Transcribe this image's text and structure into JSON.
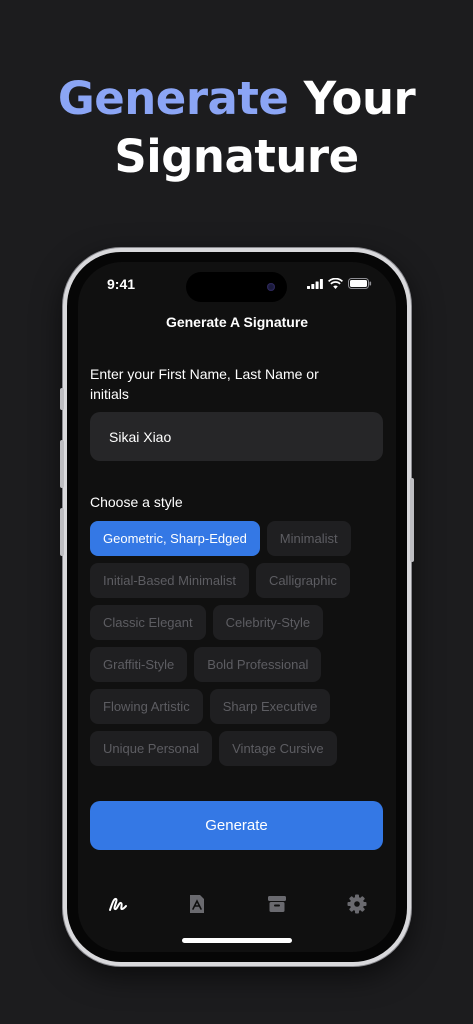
{
  "hero": {
    "title_accent": "Generate",
    "title_rest_line1": " Your",
    "title_line2": "Signature",
    "accent_color": "#8ba5f5"
  },
  "status_bar": {
    "time": "9:41",
    "icons": [
      "cellular-signal-icon",
      "wifi-icon",
      "battery-icon"
    ]
  },
  "screen": {
    "title": "Generate A Signature",
    "prompt": "Enter your First Name, Last Name or initials",
    "name_input": {
      "value": "Sikai Xiao",
      "placeholder": ""
    },
    "style_label": "Choose a style",
    "styles": [
      [
        "Geometric, Sharp-Edged",
        "Minimalist"
      ],
      [
        "Initial-Based Minimalist",
        "Calligraphic"
      ],
      [
        "Classic Elegant",
        "Celebrity-Style"
      ],
      [
        "Graffiti-Style",
        "Bold Professional"
      ],
      [
        "Flowing Artistic",
        "Sharp Executive"
      ],
      [
        "Unique Personal",
        "Vintage Cursive"
      ]
    ],
    "selected_style": "Geometric, Sharp-Edged",
    "generate_label": "Generate",
    "primary_color": "#3478e5"
  },
  "tab_bar": {
    "tabs": [
      {
        "icon": "signature-icon",
        "active": true
      },
      {
        "icon": "pdf-document-icon",
        "active": false
      },
      {
        "icon": "archive-box-icon",
        "active": false
      },
      {
        "icon": "gear-icon",
        "active": false
      }
    ]
  }
}
